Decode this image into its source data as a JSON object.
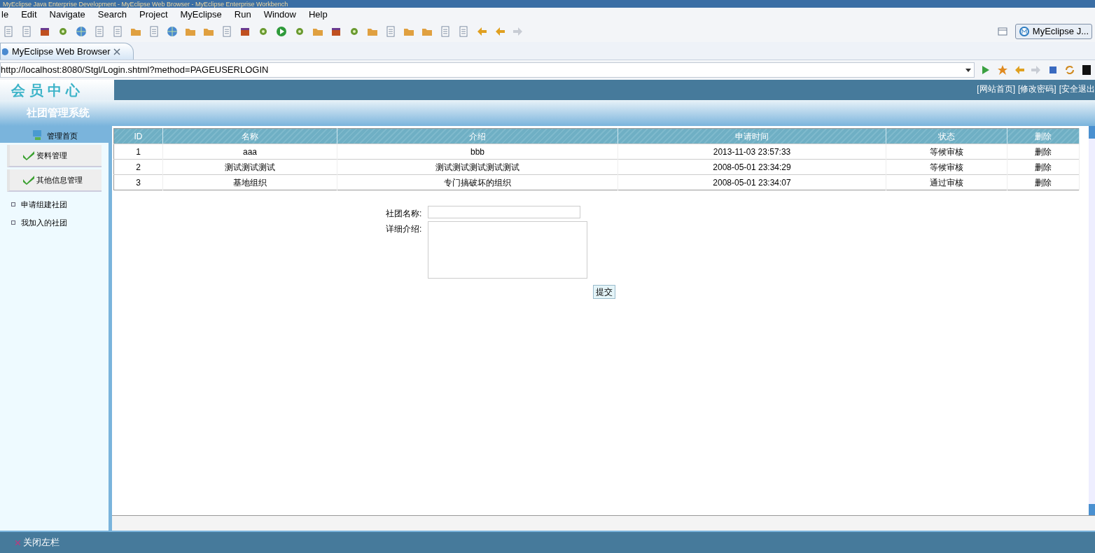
{
  "window": {
    "title": "MyEclipse Java Enterprise Development - MyEclipse Web Browser - MyEclipse Enterprise Workbench"
  },
  "menu": [
    "le",
    "Edit",
    "Navigate",
    "Search",
    "Project",
    "MyEclipse",
    "Run",
    "Window",
    "Help"
  ],
  "perspective": {
    "label": "MyEclipse J..."
  },
  "tabs": [
    {
      "label": "MyEclipse Web Browser",
      "selected": true
    }
  ],
  "address_bar": {
    "value": "http://localhost:8080/Stgl/Login.shtml?method=PAGEUSERLOGIN"
  },
  "page": {
    "logo": "会员中心",
    "top_links": [
      "[网站首页]",
      "[修改密码]",
      "[安全退出"
    ],
    "system_title": "社团管理系统",
    "sidebar": {
      "home": "管理首页",
      "sections": [
        "资料管理",
        "其他信息管理"
      ],
      "links": [
        "申请组建社团",
        "我加入的社团"
      ]
    },
    "table": {
      "columns": [
        "ID",
        "名称",
        "介绍",
        "申请时间",
        "状态",
        "删除"
      ],
      "rows": [
        [
          "1",
          "aaa",
          "bbb",
          "2013-11-03 23:57:33",
          "等候审核",
          "删除"
        ],
        [
          "2",
          "测试测试测试",
          "测试测试测试测试测试",
          "2008-05-01 23:34:29",
          "等候审核",
          "删除"
        ],
        [
          "3",
          "基地组织",
          "专门搞破坏的组织",
          "2008-05-01 23:34:07",
          "通过审核",
          "删除"
        ]
      ]
    },
    "form": {
      "fields": [
        {
          "label": "社团名称:",
          "kind": "text"
        },
        {
          "label": "详细介绍:",
          "kind": "textarea"
        }
      ],
      "submit": "提交"
    },
    "footer": {
      "close_sidebar": "关闭左栏"
    }
  }
}
